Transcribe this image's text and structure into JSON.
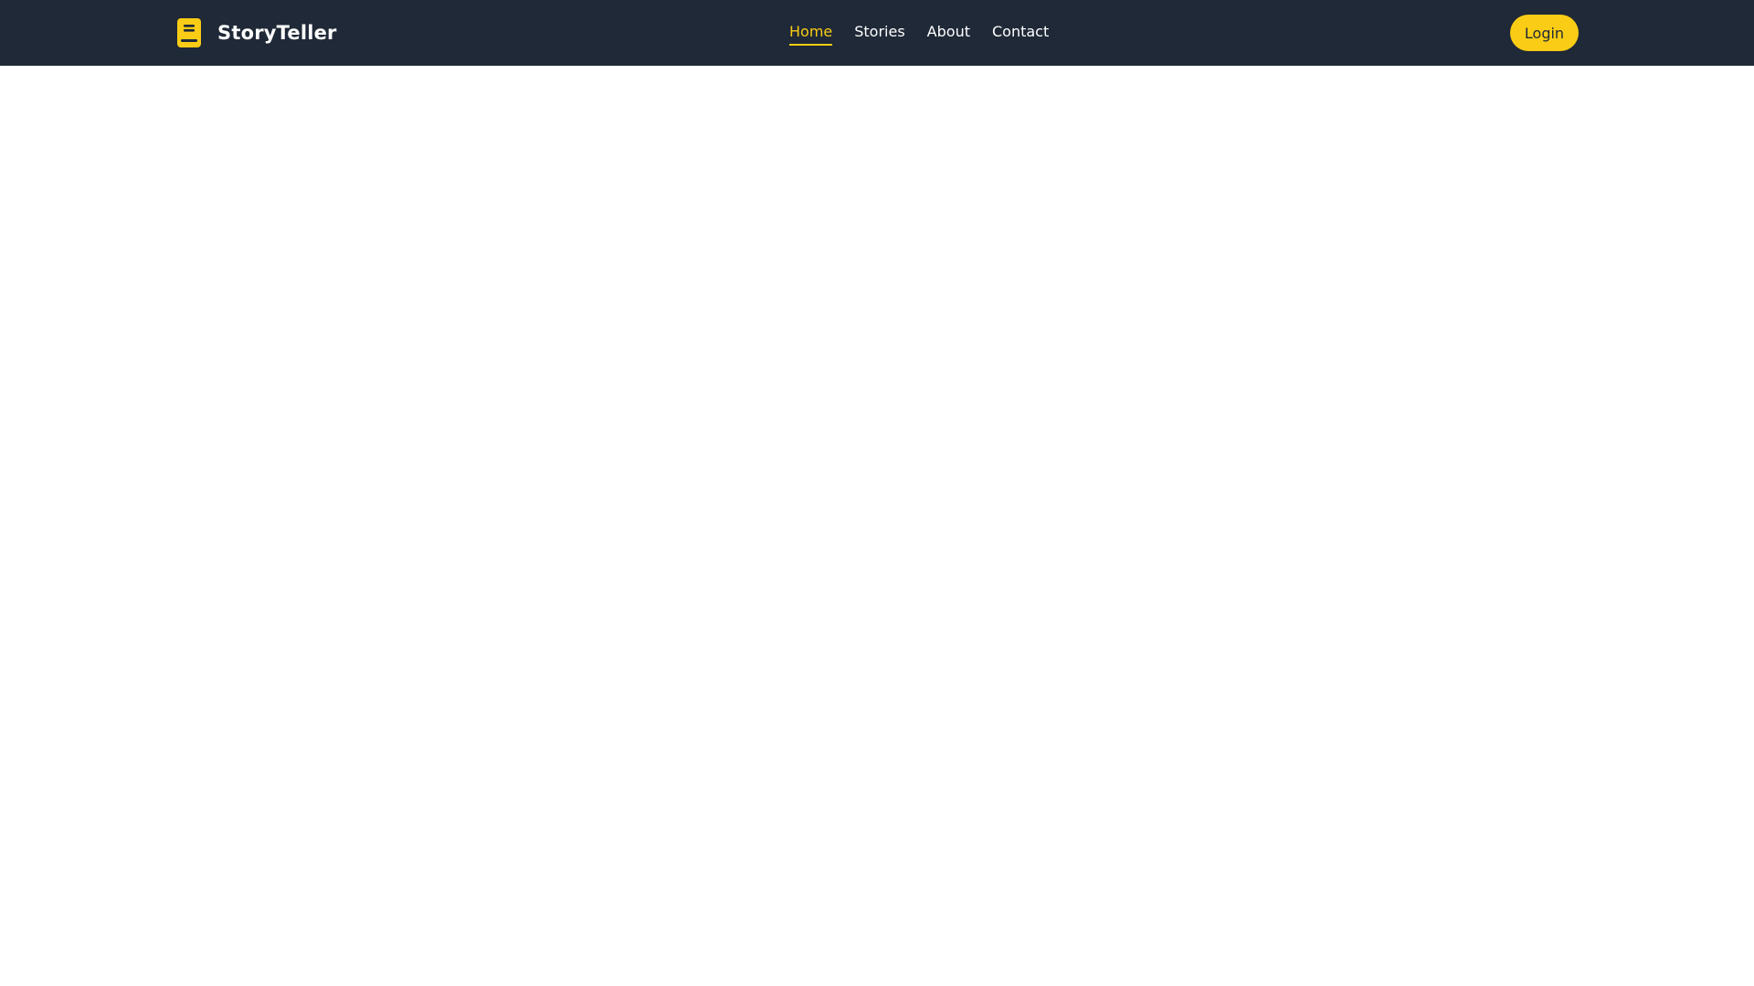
{
  "brand": {
    "name": "StoryTeller",
    "icon": "book-icon"
  },
  "nav": {
    "items": [
      {
        "label": "Home",
        "active": true
      },
      {
        "label": "Stories",
        "active": false
      },
      {
        "label": "About",
        "active": false
      },
      {
        "label": "Contact",
        "active": false
      }
    ]
  },
  "header": {
    "login_label": "Login"
  },
  "colors": {
    "navbar_bg": "#1f2937",
    "accent": "#facc15",
    "text": "#ffffff"
  }
}
